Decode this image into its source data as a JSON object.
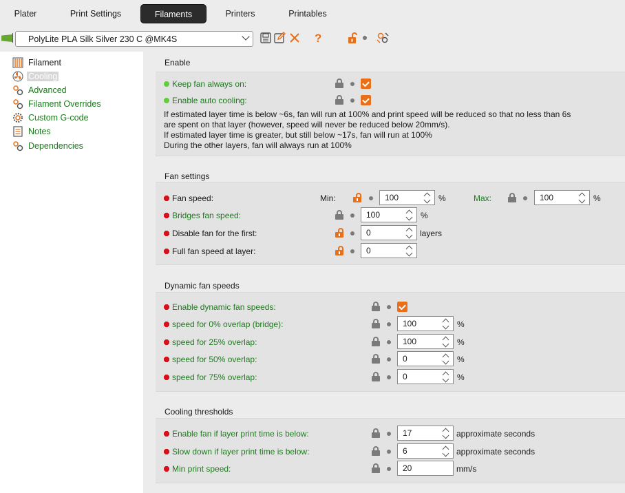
{
  "tabs": [
    {
      "label": "Plater",
      "active": false
    },
    {
      "label": "Print Settings",
      "active": false
    },
    {
      "label": "Filaments",
      "active": true
    },
    {
      "label": "Printers",
      "active": false
    },
    {
      "label": "Printables",
      "active": false
    }
  ],
  "preset": {
    "selected": "PolyLite PLA Silk Silver 230 C @MK4S"
  },
  "toolbar_icons": [
    "save-icon",
    "edit-icon",
    "delete-icon",
    "help-icon",
    "unlock-icon",
    "compare-icon"
  ],
  "sidebar": {
    "items": [
      {
        "label": "Filament",
        "icon": "filament-icon"
      },
      {
        "label": "Cooling",
        "icon": "fan-icon"
      },
      {
        "label": "Advanced",
        "icon": "cogs-icon"
      },
      {
        "label": "Filament Overrides",
        "icon": "cogs-icon"
      },
      {
        "label": "Custom G-code",
        "icon": "gear-icon"
      },
      {
        "label": "Notes",
        "icon": "notes-icon"
      },
      {
        "label": "Dependencies",
        "icon": "cogs-icon"
      }
    ]
  },
  "enable": {
    "title": "Enable",
    "keep_fan": "Keep fan always on:",
    "auto_cooling": "Enable auto cooling:",
    "desc1": "If estimated layer time is below ~6s, fan will run at 100% and print speed will be reduced so that no less than 6s",
    "desc2": "are spent on that layer (however, speed will never be reduced below 20mm/s).",
    "desc3": "If estimated layer time is greater, but still below ~17s, fan will run at 100%",
    "desc4": "During the other layers, fan will always run at 100%"
  },
  "fan": {
    "title": "Fan settings",
    "fan_speed": "Fan speed:",
    "min_label": "Min:",
    "min_value": "100",
    "max_label": "Max:",
    "max_value": "100",
    "pct": "%",
    "bridges": "Bridges fan speed:",
    "bridges_value": "100",
    "disable_first": "Disable fan for the first:",
    "disable_value": "0",
    "layers": "layers",
    "full_speed": "Full fan speed at layer:",
    "full_value": "0"
  },
  "dynamic": {
    "title": "Dynamic fan speeds",
    "enable": "Enable dynamic fan speeds:",
    "o0": "speed for 0% overlap (bridge):",
    "o0_value": "100",
    "o25": "speed for 25% overlap:",
    "o25_value": "100",
    "o50": "speed for 50% overlap:",
    "o50_value": "0",
    "o75": "speed for 75% overlap:",
    "o75_value": "0"
  },
  "thresholds": {
    "title": "Cooling thresholds",
    "enable_fan": "Enable fan if layer print time is below:",
    "enable_fan_value": "17",
    "slow_down": "Slow down if layer print time is below:",
    "slow_down_value": "6",
    "approx": "approximate seconds",
    "min_speed": "Min print speed:",
    "min_speed_value": "20",
    "mms": "mm/s"
  },
  "colors": {
    "accent": "#e8701a",
    "green_text": "#1e7a1e",
    "dark_tab": "#2b2b2b"
  }
}
